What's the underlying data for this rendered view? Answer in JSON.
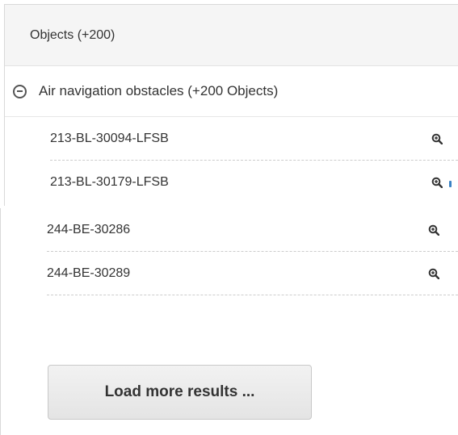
{
  "panel": {
    "header_title": "Objects (+200)"
  },
  "group": {
    "label": "Air navigation obstacles (+200 Objects)",
    "icon": "minus-circle-icon"
  },
  "items": [
    {
      "label": "213-BL-30094-LFSB",
      "action_icon": "zoom-in-icon"
    },
    {
      "label": "213-BL-30179-LFSB",
      "action_icon": "zoom-in-icon"
    },
    {
      "label": "244-BE-30286",
      "action_icon": "zoom-in-icon"
    },
    {
      "label": "244-BE-30289",
      "action_icon": "zoom-in-icon"
    }
  ],
  "load_more_label": "Load more results ...",
  "colors": {
    "header_bg": "#f5f5f5",
    "text": "#333333",
    "icon": "#555555",
    "accent": "#3a82c4"
  }
}
